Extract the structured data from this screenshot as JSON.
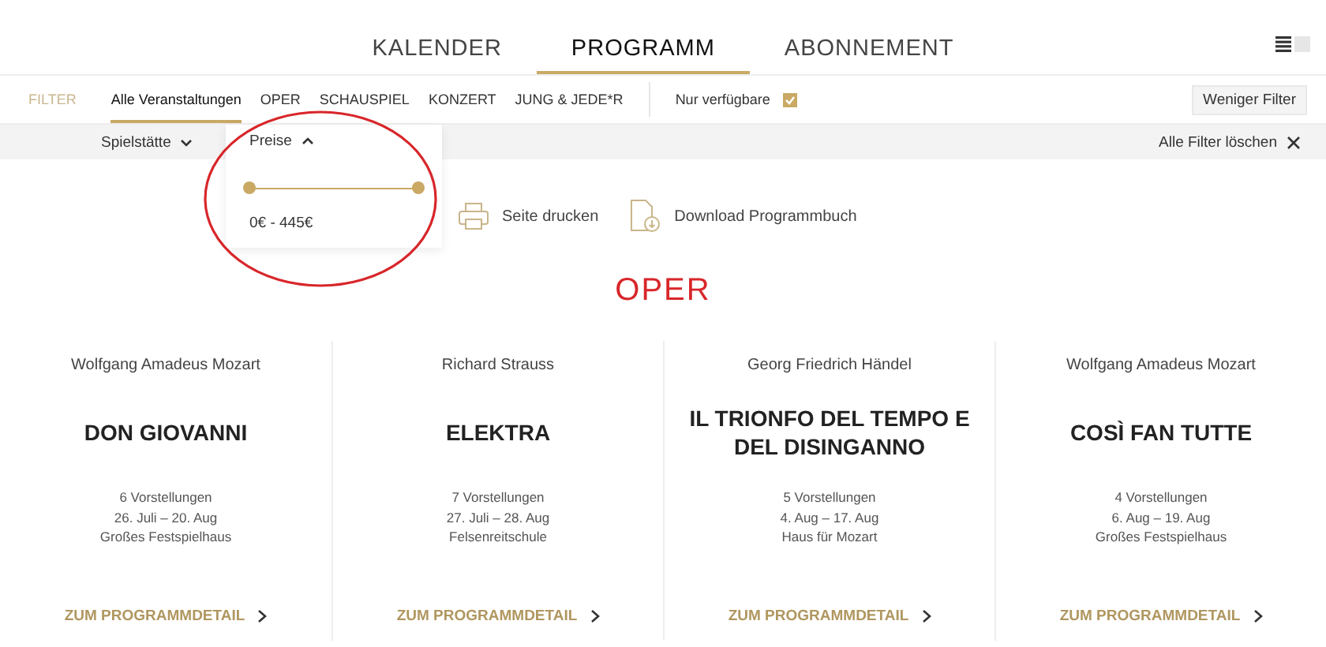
{
  "nav": {
    "tabs": [
      {
        "label": "KALENDER",
        "selected": false
      },
      {
        "label": "PROGRAMM",
        "selected": true
      },
      {
        "label": "ABONNEMENT",
        "selected": false
      }
    ]
  },
  "filter": {
    "label": "FILTER",
    "categories": [
      {
        "label": "Alle Veranstaltungen",
        "selected": true
      },
      {
        "label": "OPER",
        "selected": false
      },
      {
        "label": "SCHAUSPIEL",
        "selected": false
      },
      {
        "label": "KONZERT",
        "selected": false
      },
      {
        "label": "JUNG & JEDE*R",
        "selected": false
      }
    ],
    "available": {
      "label": "Nur verfügbare",
      "checked": true
    },
    "less_button": "Weniger Filter"
  },
  "filter_bar": {
    "dropdowns": [
      {
        "label": "Spielstätte",
        "expanded": false
      },
      {
        "label": "Preise",
        "expanded": true
      }
    ],
    "clear": "Alle Filter löschen"
  },
  "price_panel": {
    "thumbs": [
      {
        "level": 0
      },
      {
        "level": 1
      }
    ],
    "range": "0€ - 445€"
  },
  "actions": [
    "Seite drucken",
    "Download Programmbuch"
  ],
  "section_title": "OPER",
  "cards": [
    {
      "composer": "Wolfgang Amadeus Mozart",
      "title": "DON GIOVANNI",
      "performances": "6 Vorstellungen",
      "dates": "26. Juli – 20. Aug",
      "venue": "Großes Festspielhaus",
      "link": "ZUM PROGRAMMDETAIL"
    },
    {
      "composer": "Richard Strauss",
      "title": "ELEKTRA",
      "performances": "7 Vorstellungen",
      "dates": "27. Juli – 28. Aug",
      "venue": "Felsenreitschule",
      "link": "ZUM PROGRAMMDETAIL"
    },
    {
      "composer": "Georg Friedrich Händel",
      "title": "IL TRIONFO DEL TEMPO E DEL DISINGANNO",
      "performances": "5 Vorstellungen",
      "dates": "4. Aug – 17. Aug",
      "venue": "Haus für Mozart",
      "link": "ZUM PROGRAMMDETAIL"
    },
    {
      "composer": "Wolfgang Amadeus Mozart",
      "title": "COSÌ FAN TUTTE",
      "performances": "4 Vorstellungen",
      "dates": "6. Aug – 19. Aug",
      "venue": "Großes Festspielhaus",
      "link": "ZUM PROGRAMMDETAIL"
    }
  ]
}
